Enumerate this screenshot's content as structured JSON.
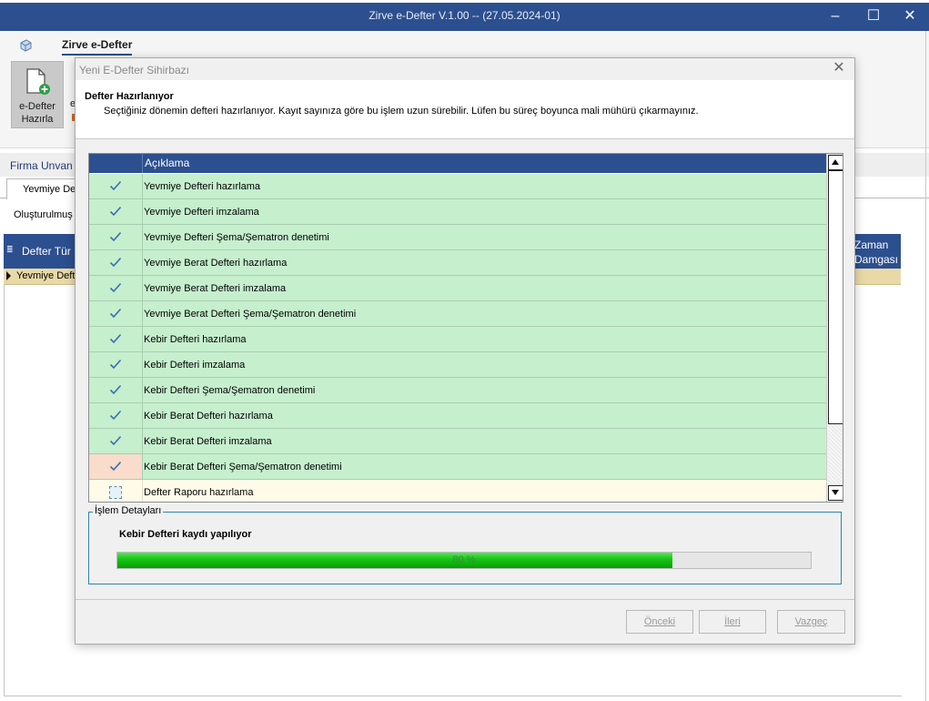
{
  "window": {
    "title": "Zirve e-Defter V.1.00  -- (27.05.2024-01)",
    "controls": {
      "minimize": "–",
      "maximize": "☐",
      "close": "✕"
    }
  },
  "ribbon": {
    "tab": "Zirve e-Defter",
    "create_button": "e-Defter Hazırla",
    "next_button_partial": "e"
  },
  "background": {
    "firma_label": "Firma Unvan",
    "tab": "Yevmiye Def",
    "subtitle": "Oluşturulmuş",
    "grid_col1": "Defter Tür",
    "grid_col_last": "Zaman\nDamgası",
    "row_cell": "Yevmiye Deft"
  },
  "dialog": {
    "title": "Yeni E-Defter Sihirbazı",
    "heading": "Defter Hazırlanıyor",
    "subheading": "Seçtiğiniz dönemin defteri hazırlanıyor. Kayıt sayınıza göre bu işlem uzun sürebilir. Lüfen bu süreç boyunca mali mühürü çıkarmayınız.",
    "steps_header": "Açıklama",
    "steps": [
      {
        "label": "Yevmiye Defteri hazırlama",
        "state": "done"
      },
      {
        "label": "Yevmiye Defteri imzalama",
        "state": "done"
      },
      {
        "label": "Yevmiye Defteri Şema/Şematron denetimi",
        "state": "done"
      },
      {
        "label": "Yevmiye Berat Defteri hazırlama",
        "state": "done"
      },
      {
        "label": "Yevmiye Berat Defteri imzalama",
        "state": "done"
      },
      {
        "label": "Yevmiye Berat Defteri Şema/Şematron denetimi",
        "state": "done"
      },
      {
        "label": "Kebir Defteri hazırlama",
        "state": "done"
      },
      {
        "label": "Kebir Defteri imzalama",
        "state": "done"
      },
      {
        "label": "Kebir Defteri Şema/Şematron denetimi",
        "state": "done"
      },
      {
        "label": "Kebir Berat Defteri hazırlama",
        "state": "done"
      },
      {
        "label": "Kebir Berat Defteri imzalama",
        "state": "done"
      },
      {
        "label": "Kebir Berat Defteri Şema/Şematron denetimi",
        "state": "current"
      },
      {
        "label": "Defter Raporu hazırlama",
        "state": "pending"
      }
    ],
    "details_legend": "İşlem Detayları",
    "operation": "Kebir Defteri kaydı yapılıyor",
    "progress_percent": 80,
    "progress_text": "80 %",
    "buttons": {
      "back": "Önceki",
      "next": "İleri",
      "cancel": "Vazgeç"
    }
  },
  "colors": {
    "titlebar": "#2c4f8f",
    "done_row": "#c6efce",
    "pending_row": "#fffbe8",
    "progress": "#17c717"
  }
}
